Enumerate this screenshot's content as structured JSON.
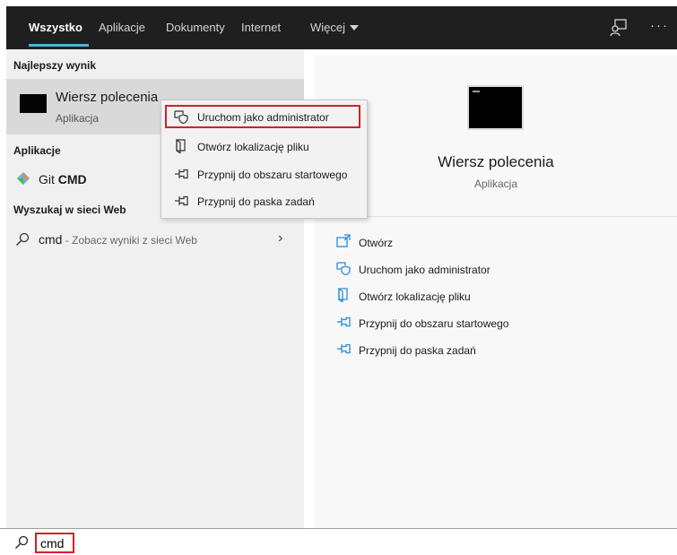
{
  "tabs": [
    {
      "label": "Wszystko"
    },
    {
      "label": "Aplikacje"
    },
    {
      "label": "Dokumenty"
    },
    {
      "label": "Internet"
    },
    {
      "label": "Więcej"
    }
  ],
  "accent_color": "#4fb3d9",
  "highlight_color": "#d32029",
  "left": {
    "best_heading": "Najlepszy wynik",
    "best": {
      "title": "Wiersz polecenia",
      "subtitle": "Aplikacja",
      "icon": "cmd-icon"
    },
    "apps_heading": "Aplikacje",
    "app": {
      "prefix": "Git ",
      "bold": "CMD",
      "icon": "git-icon"
    },
    "web_heading": "Wyszukaj w sieci Web",
    "web": {
      "query": "cmd",
      "suffix": " - Zobacz wyniki z sieci Web",
      "icon": "search-icon"
    }
  },
  "right": {
    "title": "Wiersz polecenia",
    "subtitle": "Aplikacja",
    "actions": [
      {
        "label": "Otwórz",
        "icon": "open-icon"
      },
      {
        "label": "Uruchom jako administrator",
        "icon": "run-as-admin-icon"
      },
      {
        "label": "Otwórz lokalizację pliku",
        "icon": "file-location-icon"
      },
      {
        "label": "Przypnij do obszaru startowego",
        "icon": "pin-icon"
      },
      {
        "label": "Przypnij do paska zadań",
        "icon": "pin-icon"
      }
    ]
  },
  "context_menu": {
    "items": [
      {
        "label": "Uruchom jako administrator",
        "icon": "run-as-admin-icon"
      },
      {
        "label": "Otwórz lokalizację pliku",
        "icon": "file-location-icon"
      },
      {
        "label": "Przypnij do obszaru startowego",
        "icon": "pin-icon"
      },
      {
        "label": "Przypnij do paska zadań",
        "icon": "pin-icon"
      }
    ]
  },
  "search": {
    "value": "cmd"
  }
}
